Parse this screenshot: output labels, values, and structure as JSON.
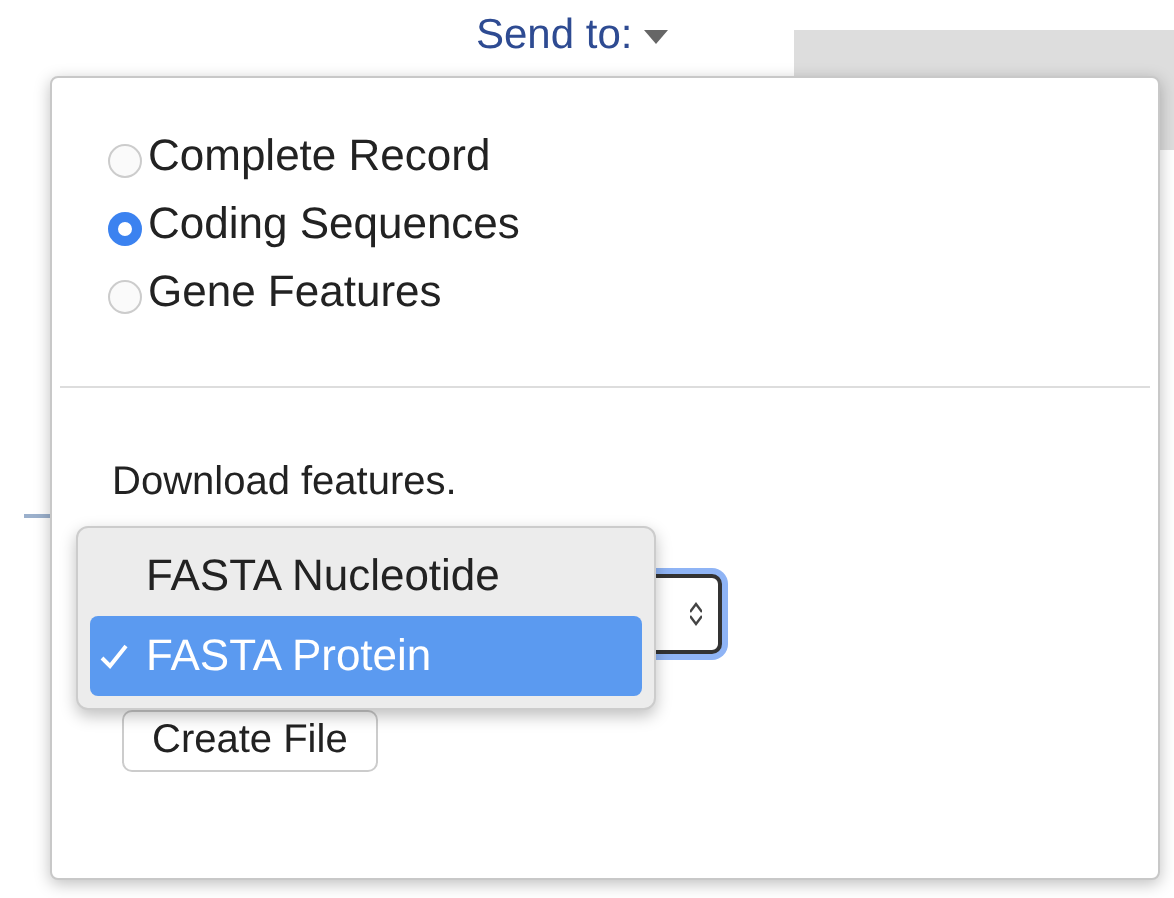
{
  "send_to": {
    "label": "Send to:"
  },
  "options": [
    {
      "label": "Complete Record",
      "selected": false
    },
    {
      "label": "Coding Sequences",
      "selected": true
    },
    {
      "label": "Gene Features",
      "selected": false
    }
  ],
  "download": {
    "label": "Download features.",
    "format_menu": [
      {
        "label": "FASTA Nucleotide",
        "selected": false
      },
      {
        "label": "FASTA Protein",
        "selected": true
      }
    ],
    "button": "Create File"
  }
}
